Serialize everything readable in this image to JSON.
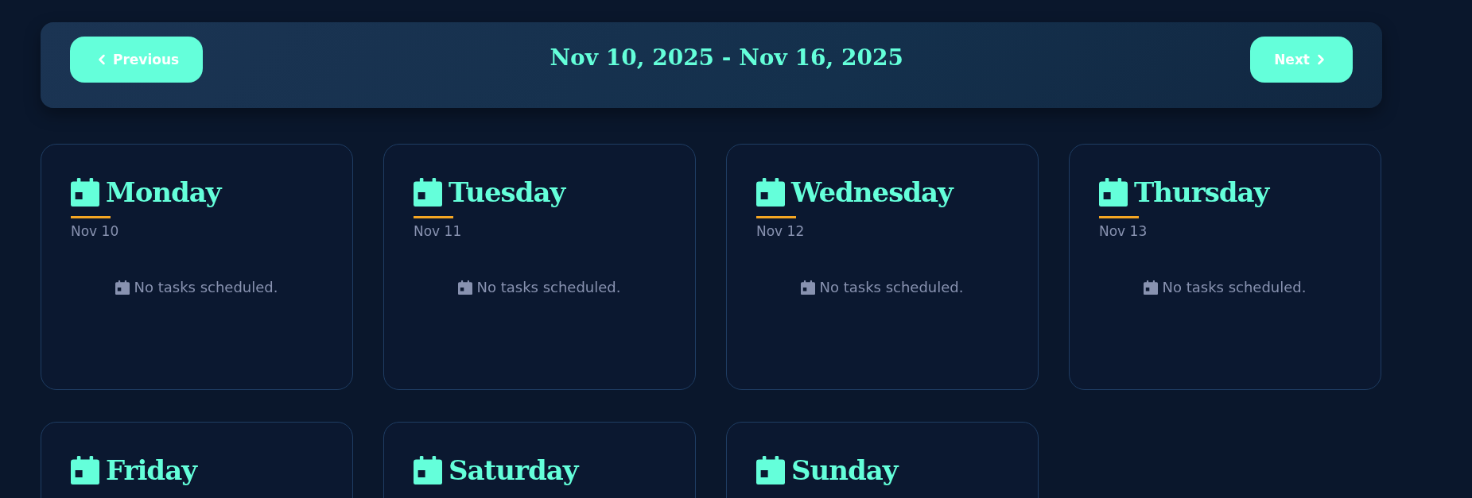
{
  "week_nav": {
    "previous": {
      "label": "Previous"
    },
    "range": "Nov 10, 2025 - Nov 16, 2025",
    "next": {
      "label": "Next"
    }
  },
  "days": [
    {
      "day": "Monday",
      "date": "Nov 10",
      "empty_message": "No tasks scheduled."
    },
    {
      "day": "Tuesday",
      "date": "Nov 11",
      "empty_message": "No tasks scheduled."
    },
    {
      "day": "Wednesday",
      "date": "Nov 12",
      "empty_message": "No tasks scheduled."
    },
    {
      "day": "Thursday",
      "date": "Nov 13",
      "empty_message": "No tasks scheduled."
    },
    {
      "day": "Friday"
    },
    {
      "day": "Saturday"
    },
    {
      "day": "Sunday"
    }
  ]
}
